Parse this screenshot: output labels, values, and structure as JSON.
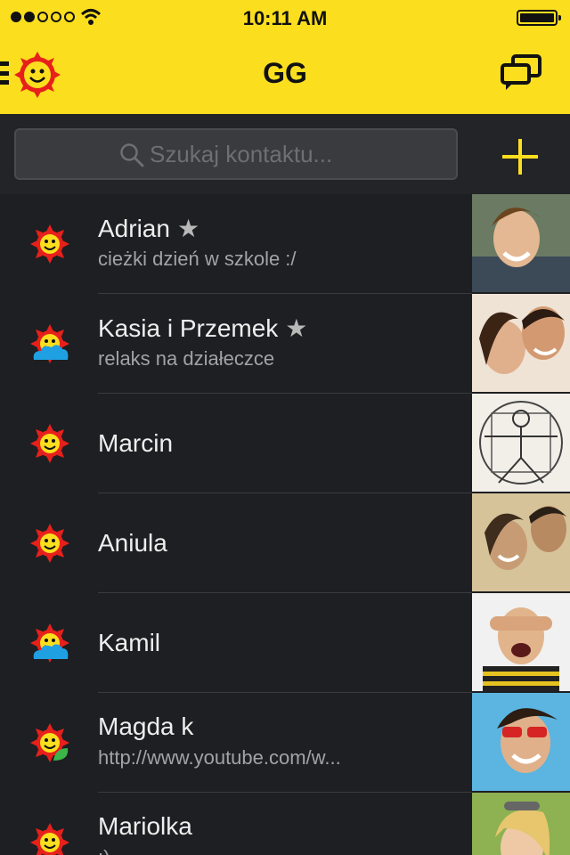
{
  "status_bar": {
    "time": "10:11 AM",
    "signal_filled": 2,
    "signal_total": 5,
    "battery": 1.0
  },
  "header": {
    "title": "GG",
    "logo_icon": "gg-sun-logo-icon",
    "menu_icon": "hamburger-icon",
    "chat_icon": "chat-bubbles-icon",
    "accent_color": "#fbde1e"
  },
  "search": {
    "placeholder": "Szukaj kontaktu...",
    "value": "",
    "icon": "search-icon",
    "add_icon": "plus-icon"
  },
  "contacts": [
    {
      "name": "Adrian",
      "favorite": "★",
      "status_text": "cieżki dzień w szkole :/",
      "status_icon": "sun-available-icon"
    },
    {
      "name": "Kasia i Przemek",
      "favorite": "★",
      "status_text": "relaks na działeczce",
      "status_icon": "sun-cloud-away-icon"
    },
    {
      "name": "Marcin",
      "favorite": "",
      "status_text": "",
      "status_icon": "sun-available-icon"
    },
    {
      "name": "Aniula",
      "favorite": "",
      "status_text": "",
      "status_icon": "sun-available-icon"
    },
    {
      "name": "Kamil",
      "favorite": "",
      "status_text": "",
      "status_icon": "sun-cloud-away-icon"
    },
    {
      "name": "Magda k",
      "favorite": "",
      "status_text": "http://www.youtube.com/w...",
      "status_icon": "sun-mobile-icon"
    },
    {
      "name": "Mariolka",
      "favorite": "",
      "status_text": ":)",
      "status_icon": "sun-available-icon"
    }
  ]
}
